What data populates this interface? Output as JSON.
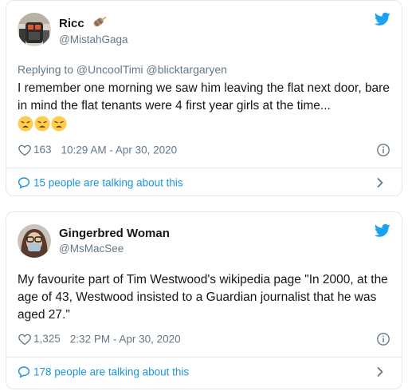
{
  "colors": {
    "link": "#1b95e0",
    "twitter_blue": "#1da1f2",
    "muted": "#657786",
    "text": "#14171a",
    "border": "#e1e8ed"
  },
  "tweets": [
    {
      "display_name": "Ricc",
      "name_emoji": "ice-pop-emoji",
      "handle": "@MistahGaga",
      "reply_to": "Replying to @UncoolTimi @blicktargaryen",
      "text": "I remember one morning we saw him leaving the flat next door, bare in mind the flat tenants were 4 first year girls at the time...",
      "emojis": [
        "weary-face-emoji",
        "weary-face-emoji",
        "weary-face-emoji"
      ],
      "likes": "163",
      "timestamp": "10:29 AM - Apr 30, 2020",
      "talking": "15 people are talking about this"
    },
    {
      "display_name": "Gingerbred Woman",
      "handle": "@MsMacSee",
      "text": "My favourite part of Tim Westwood's wikipedia page \"In 2000, at the age of 43, Westwood insisted to a Guardian journalist that he was aged 27.\"",
      "likes": "1,325",
      "timestamp": "2:32 PM - Apr 30, 2020",
      "talking": "178 people are talking about this"
    }
  ]
}
